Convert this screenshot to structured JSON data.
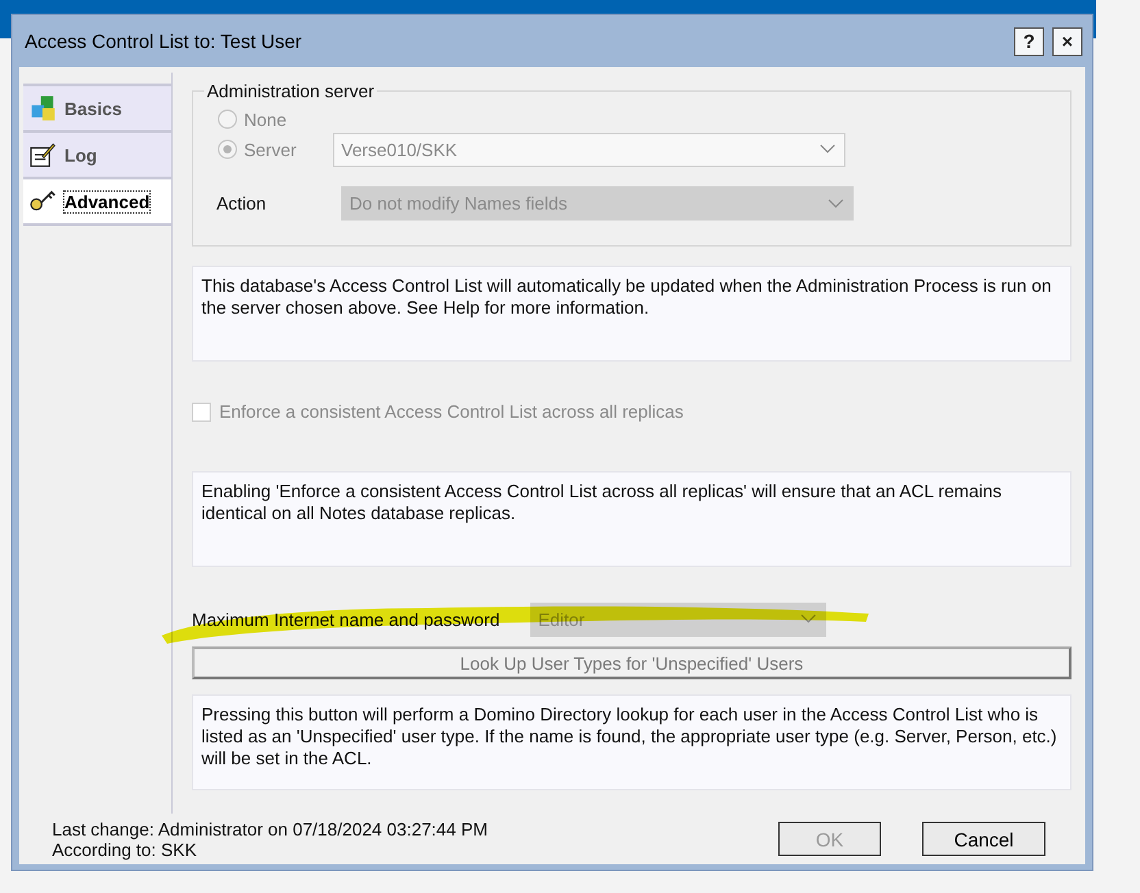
{
  "window": {
    "title": "Access Control List to: Test User",
    "help_button": "?",
    "close_button": "×"
  },
  "tabs": [
    {
      "label": "Basics",
      "selected": false
    },
    {
      "label": "Log",
      "selected": false
    },
    {
      "label": "Advanced",
      "selected": true
    }
  ],
  "administration_server": {
    "label": "Administration server",
    "options": [
      {
        "label": "None",
        "selected": false,
        "disabled": true
      },
      {
        "label": "Server",
        "selected": true,
        "disabled": true
      }
    ],
    "server": {
      "value": "Verse010/SKK",
      "disabled": true
    },
    "action": {
      "label": "Action",
      "value": "Do not modify Names fields",
      "disabled": true
    }
  },
  "info_admin": "This database's Access Control List will automatically be updated when the Administration Process is run on the server chosen above. See Help for more information.",
  "enforce": {
    "label": "Enforce a consistent Access Control List across all replicas",
    "checked": false,
    "disabled": true
  },
  "info_enforce": "Enabling 'Enforce a consistent Access Control List across all replicas' will ensure that an ACL remains identical on all Notes database replicas.",
  "max_internet": {
    "label": "Maximum Internet name and password",
    "value": "Editor",
    "disabled": true
  },
  "lookup_button": {
    "label": "Look Up User Types for 'Unspecified' Users",
    "disabled": true
  },
  "info_lookup": "Pressing this button will perform a Domino Directory lookup for each user in the Access Control List who is listed as an 'Unspecified' user type.  If the name is found, the appropriate user type (e.g. Server, Person, etc.) will be set in the ACL.",
  "footer": {
    "last_change": "Last change: Administrator on 07/18/2024 03:27:44 PM",
    "according_to": "According to: SKK"
  },
  "buttons": [
    {
      "label": "OK",
      "disabled": true
    },
    {
      "label": "Cancel",
      "disabled": false
    }
  ]
}
